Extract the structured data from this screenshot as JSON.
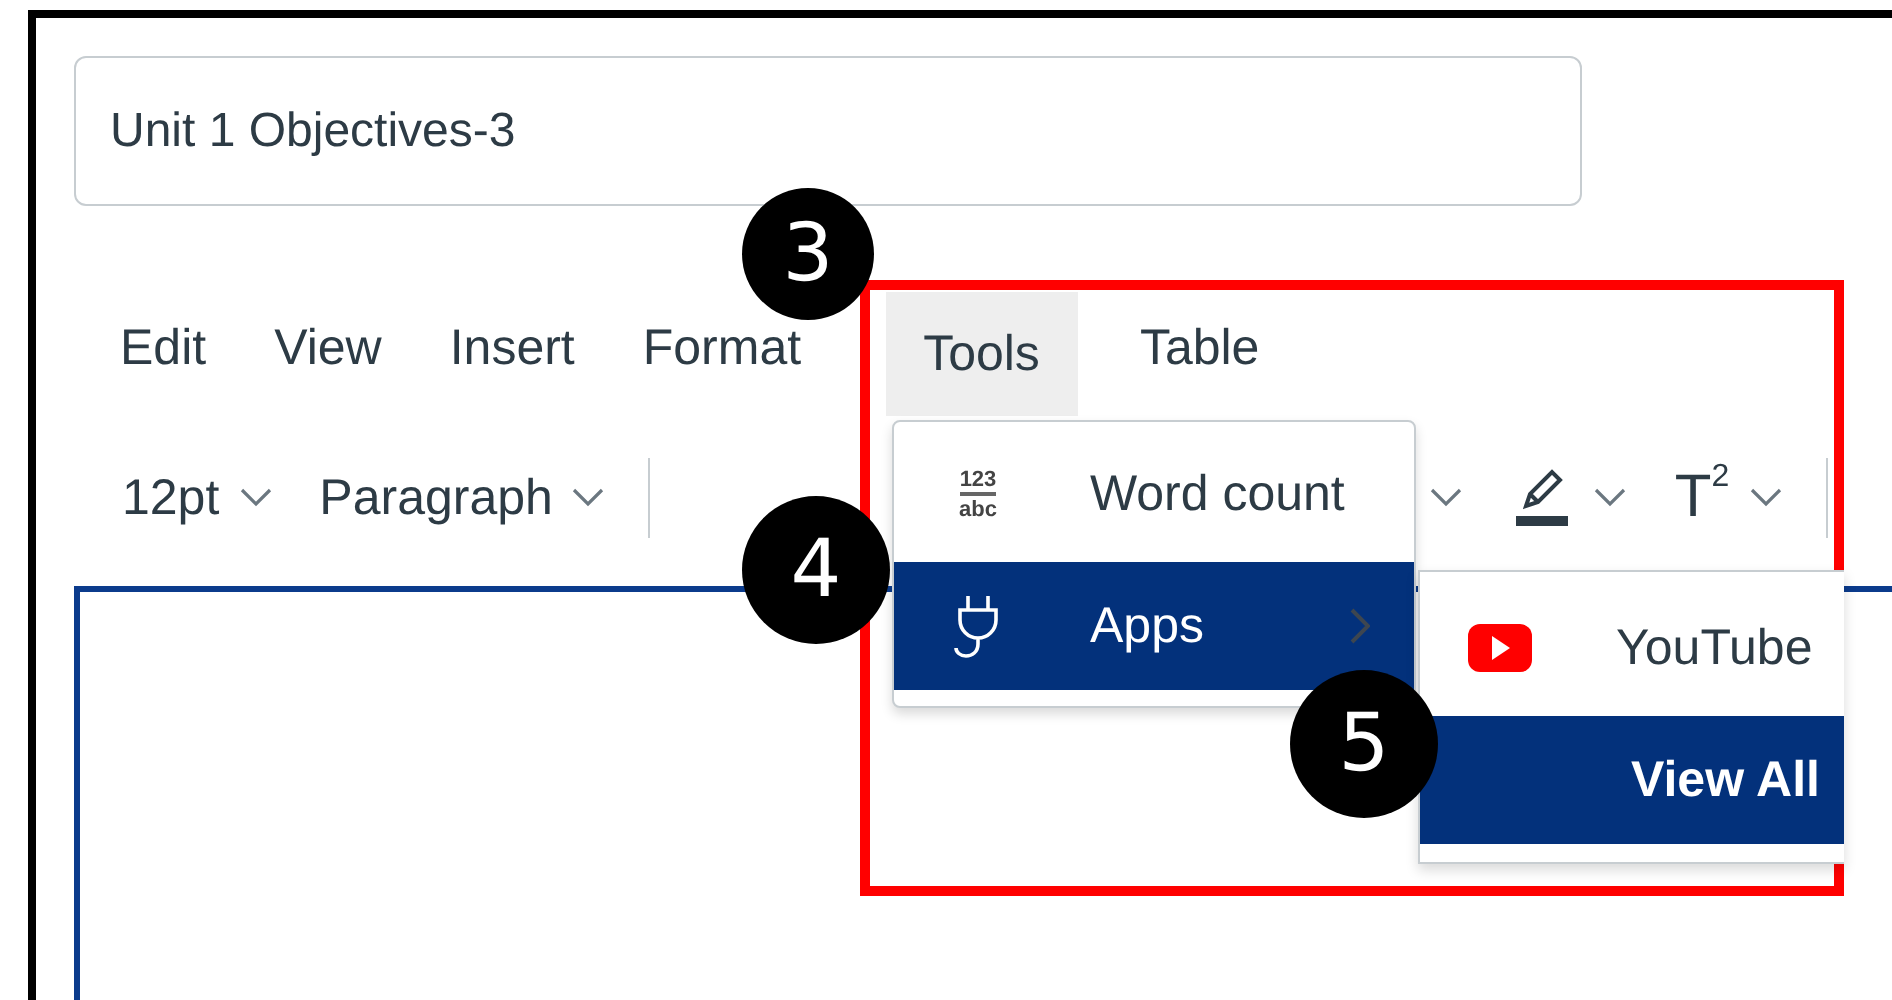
{
  "title_field": {
    "value": "Unit 1 Objectives-3"
  },
  "menubar": [
    {
      "label": "Edit",
      "selected": false
    },
    {
      "label": "View",
      "selected": false
    },
    {
      "label": "Insert",
      "selected": false
    },
    {
      "label": "Format",
      "selected": false
    },
    {
      "label": "Tools",
      "selected": true
    },
    {
      "label": "Table",
      "selected": false
    }
  ],
  "toolbar": [
    {
      "kind": "dropdown",
      "label": "12pt"
    },
    {
      "kind": "dropdown",
      "label": "Paragraph"
    },
    {
      "kind": "divider"
    },
    {
      "kind": "chevron"
    },
    {
      "kind": "highlight"
    },
    {
      "kind": "superscript",
      "label": "T$^{2}$"
    },
    {
      "kind": "divider"
    }
  ],
  "tools_menu": {
    "items": [
      {
        "kind": "word_count",
        "label": "Word count",
        "icon_text": [
          "123",
          "abc"
        ],
        "selected": false,
        "has_submenu": false
      },
      {
        "kind": "apps",
        "label": "Apps",
        "selected": true,
        "has_submenu": true
      }
    ]
  },
  "apps_submenu": {
    "items": [
      {
        "kind": "youtube",
        "label": "YouTube",
        "selected": false
      },
      {
        "kind": "view_all",
        "label": "View All",
        "selected": true
      }
    ]
  },
  "annotations": [
    {
      "label": "3"
    },
    {
      "label": "4"
    },
    {
      "label": "5"
    }
  ]
}
